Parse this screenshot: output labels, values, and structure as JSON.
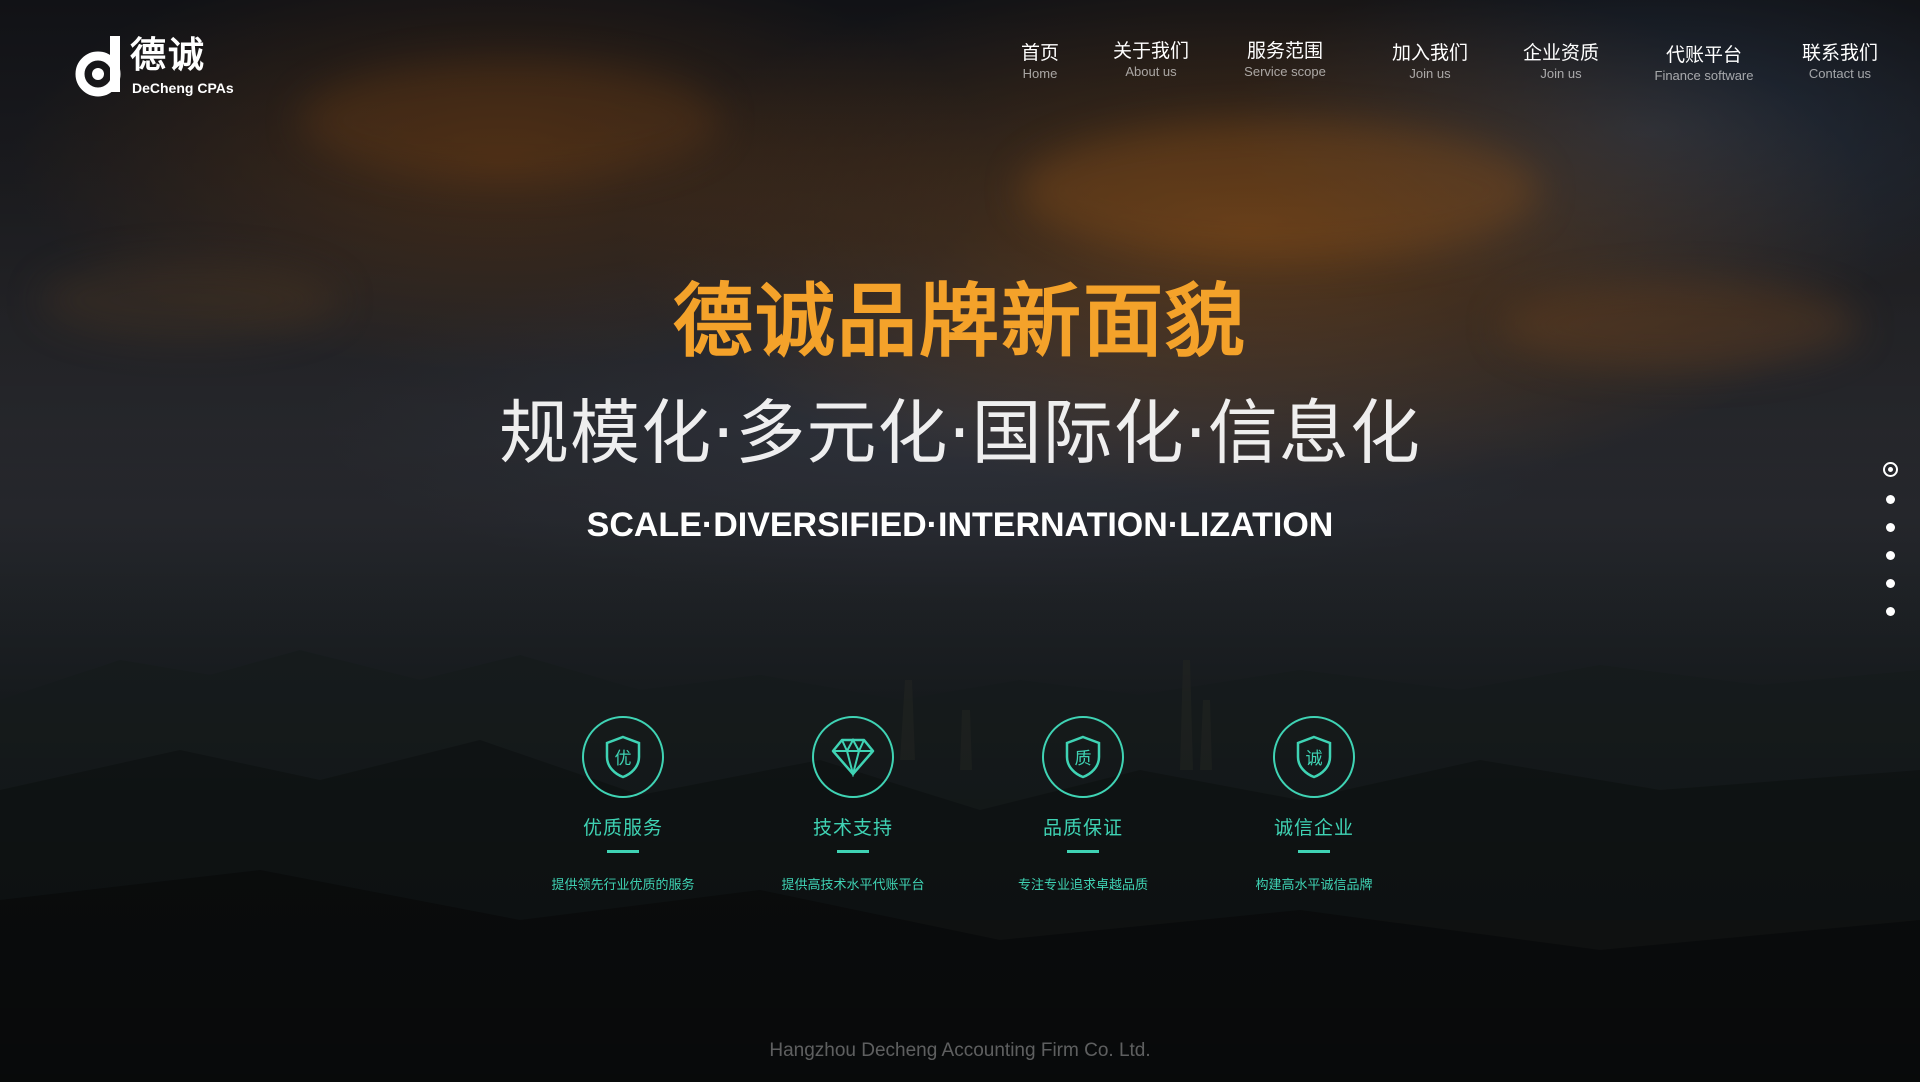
{
  "logo": {
    "name_cn": "德诚",
    "name_en": "DeCheng CPAs"
  },
  "nav": [
    {
      "cn": "首页",
      "en": "Home"
    },
    {
      "cn": "关于我们",
      "en": "About us"
    },
    {
      "cn": "服务范围",
      "en": "Service scope"
    },
    {
      "cn": "加入我们",
      "en": "Join us"
    },
    {
      "cn": "企业资质",
      "en": "Join us"
    },
    {
      "cn": "代账平台",
      "en": "Finance software"
    },
    {
      "cn": "联系我们",
      "en": "Contact us"
    }
  ],
  "hero": {
    "title": "德诚品牌新面貌",
    "subtitle": "规模化·多元化·国际化·信息化",
    "subtitle_en": "SCALE·DIVERSIFIED·INTERNATION·LIZATION"
  },
  "pager": {
    "count": 6,
    "active_index": 0
  },
  "features": [
    {
      "icon": "shield-you-icon",
      "glyph": "优",
      "title": "优质服务",
      "desc": "提供领先行业优质的服务"
    },
    {
      "icon": "diamond-icon",
      "glyph": "",
      "title": "技术支持",
      "desc": "提供高技术水平代账平台"
    },
    {
      "icon": "shield-zhi-icon",
      "glyph": "质",
      "title": "品质保证",
      "desc": "专注专业追求卓越品质"
    },
    {
      "icon": "shield-cheng-icon",
      "glyph": "诚",
      "title": "诚信企业",
      "desc": "构建高水平诚信品牌"
    }
  ],
  "footer": {
    "company": "Hangzhou Decheng Accounting Firm Co. Ltd."
  },
  "colors": {
    "accent_orange": "#f4a22a",
    "accent_teal": "#3fd3b4"
  }
}
